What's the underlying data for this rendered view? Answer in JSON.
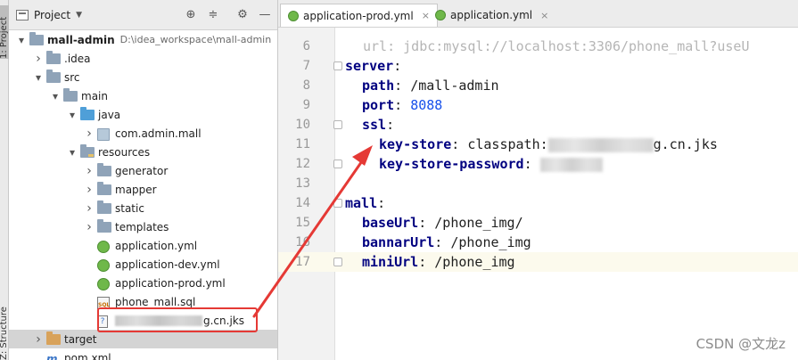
{
  "toolstrip": {
    "project_tab": "1: Project",
    "structure_tab": "Z: Structure"
  },
  "panel": {
    "title": "Project",
    "tree": [
      {
        "label": "mall-admin",
        "hint": "D:\\idea_workspace\\mall-admin",
        "depth": 0,
        "arrow": "open",
        "icon": "module-folder",
        "bold": true
      },
      {
        "label": ".idea",
        "depth": 1,
        "arrow": "closed",
        "icon": "folder"
      },
      {
        "label": "src",
        "depth": 1,
        "arrow": "open",
        "icon": "folder"
      },
      {
        "label": "main",
        "depth": 2,
        "arrow": "open",
        "icon": "folder"
      },
      {
        "label": "java",
        "depth": 3,
        "arrow": "open",
        "icon": "source-folder"
      },
      {
        "label": "com.admin.mall",
        "depth": 4,
        "arrow": "closed",
        "icon": "package"
      },
      {
        "label": "resources",
        "depth": 3,
        "arrow": "open",
        "icon": "resources-folder"
      },
      {
        "label": "generator",
        "depth": 4,
        "arrow": "closed",
        "icon": "folder"
      },
      {
        "label": "mapper",
        "depth": 4,
        "arrow": "closed",
        "icon": "folder"
      },
      {
        "label": "static",
        "depth": 4,
        "arrow": "closed",
        "icon": "folder"
      },
      {
        "label": "templates",
        "depth": 4,
        "arrow": "closed",
        "icon": "folder"
      },
      {
        "label": "application.yml",
        "depth": 4,
        "arrow": "none",
        "icon": "spring-file"
      },
      {
        "label": "application-dev.yml",
        "depth": 4,
        "arrow": "none",
        "icon": "spring-file"
      },
      {
        "label": "application-prod.yml",
        "depth": 4,
        "arrow": "none",
        "icon": "spring-file"
      },
      {
        "label": "phone_mall.sql",
        "depth": 4,
        "arrow": "none",
        "icon": "sql-file"
      },
      {
        "label": "g.cn.jks",
        "depth": 4,
        "arrow": "none",
        "icon": "unknown-file",
        "blurred_prefix": true
      },
      {
        "label": "target",
        "depth": 1,
        "arrow": "closed",
        "icon": "excluded-folder",
        "selected": true
      },
      {
        "label": "pom.xml",
        "depth": 1,
        "arrow": "none",
        "icon": "maven-file"
      }
    ]
  },
  "tabs": [
    {
      "label": "application-prod.yml",
      "active": true,
      "close": "×"
    },
    {
      "label": "application.yml",
      "active": false,
      "close": "×"
    }
  ],
  "editor": {
    "top_partial": "url: jdbc:mysql://localhost:3306/phone_mall?useU",
    "lines": [
      {
        "n": "6",
        "tokens": []
      },
      {
        "n": "7",
        "tokens": [
          {
            "t": "server",
            "c": "k"
          },
          {
            "t": ":",
            "c": "punct"
          }
        ],
        "indent": 0,
        "fold": true
      },
      {
        "n": "8",
        "tokens": [
          {
            "t": "path",
            "c": "k"
          },
          {
            "t": ": ",
            "c": "punct"
          },
          {
            "t": "/mall-admin",
            "c": "v"
          }
        ],
        "indent": 1
      },
      {
        "n": "9",
        "tokens": [
          {
            "t": "port",
            "c": "k"
          },
          {
            "t": ": ",
            "c": "punct"
          },
          {
            "t": "8088",
            "c": "num"
          }
        ],
        "indent": 1
      },
      {
        "n": "10",
        "tokens": [
          {
            "t": "ssl",
            "c": "k"
          },
          {
            "t": ":",
            "c": "punct"
          }
        ],
        "indent": 1,
        "fold": true
      },
      {
        "n": "11",
        "tokens": [
          {
            "t": "key-store",
            "c": "k"
          },
          {
            "t": ": ",
            "c": "punct"
          },
          {
            "t": "classpath:",
            "c": "v"
          },
          {
            "t": "",
            "c": "blur"
          },
          {
            "t": "g.cn.jks",
            "c": "v"
          }
        ],
        "indent": 2
      },
      {
        "n": "12",
        "tokens": [
          {
            "t": "key-store-password",
            "c": "k"
          },
          {
            "t": ": ",
            "c": "punct"
          },
          {
            "t": "",
            "c": "blur-short"
          }
        ],
        "indent": 2,
        "fold": true
      },
      {
        "n": "13",
        "tokens": []
      },
      {
        "n": "14",
        "tokens": [
          {
            "t": "mall",
            "c": "k"
          },
          {
            "t": ":",
            "c": "punct"
          }
        ],
        "indent": 0,
        "fold": true
      },
      {
        "n": "15",
        "tokens": [
          {
            "t": "baseUrl",
            "c": "k"
          },
          {
            "t": ": ",
            "c": "punct"
          },
          {
            "t": "/phone_img/",
            "c": "v"
          }
        ],
        "indent": 1
      },
      {
        "n": "16",
        "tokens": [
          {
            "t": "bannarUrl",
            "c": "k"
          },
          {
            "t": ": ",
            "c": "punct"
          },
          {
            "t": "/phone_img",
            "c": "v"
          }
        ],
        "indent": 1
      },
      {
        "n": "17",
        "tokens": [
          {
            "t": "miniUrl",
            "c": "k"
          },
          {
            "t": ": ",
            "c": "punct"
          },
          {
            "t": "/phone_img",
            "c": "v"
          }
        ],
        "indent": 1,
        "current": true,
        "fold": true
      }
    ]
  },
  "watermark": "CSDN @文龙z",
  "colors": {
    "annotation_red": "#e53935",
    "keyword": "#000080",
    "number": "#1750eb"
  }
}
